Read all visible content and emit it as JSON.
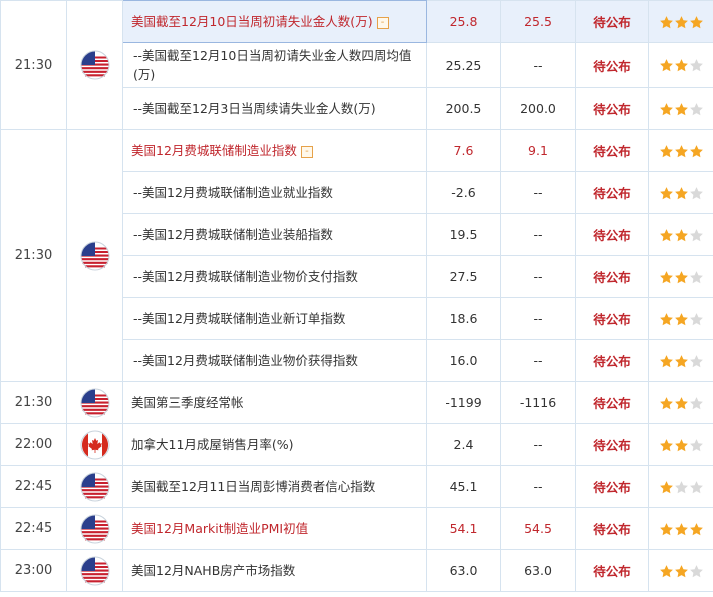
{
  "colors": {
    "highlight": "#c0272d",
    "star_on": "#f5a623",
    "star_off": "#d9d9d9",
    "border": "#d6e3ef"
  },
  "rows": [
    {
      "time": "21:30",
      "flag": "us-flag-icon",
      "name": "美国截至12月10日当周初请失业金人数(万)",
      "expand": "-",
      "previous": "25.8",
      "forecast": "25.5",
      "actual": "待公布",
      "stars": 3,
      "highlight": true,
      "selected": true
    },
    {
      "name": "--美国截至12月10日当周初请失业金人数四周均值(万)",
      "previous": "25.25",
      "forecast": "--",
      "actual": "待公布",
      "stars": 2
    },
    {
      "name": "--美国截至12月3日当周续请失业金人数(万)",
      "previous": "200.5",
      "forecast": "200.0",
      "actual": "待公布",
      "stars": 2
    },
    {
      "time": "21:30",
      "flag": "us-flag-icon",
      "name": "美国12月费城联储制造业指数",
      "expand": "-",
      "previous": "7.6",
      "forecast": "9.1",
      "actual": "待公布",
      "stars": 3,
      "highlight": true
    },
    {
      "name": "--美国12月费城联储制造业就业指数",
      "previous": "-2.6",
      "forecast": "--",
      "actual": "待公布",
      "stars": 2
    },
    {
      "name": "--美国12月费城联储制造业装船指数",
      "previous": "19.5",
      "forecast": "--",
      "actual": "待公布",
      "stars": 2
    },
    {
      "name": "--美国12月费城联储制造业物价支付指数",
      "previous": "27.5",
      "forecast": "--",
      "actual": "待公布",
      "stars": 2
    },
    {
      "name": "--美国12月费城联储制造业新订单指数",
      "previous": "18.6",
      "forecast": "--",
      "actual": "待公布",
      "stars": 2
    },
    {
      "name": "--美国12月费城联储制造业物价获得指数",
      "previous": "16.0",
      "forecast": "--",
      "actual": "待公布",
      "stars": 2
    },
    {
      "time": "21:30",
      "flag": "us-flag-icon",
      "name": "美国第三季度经常帐",
      "previous": "-1199",
      "forecast": "-1116",
      "actual": "待公布",
      "stars": 2
    },
    {
      "time": "22:00",
      "flag": "ca-flag-icon",
      "name": "加拿大11月成屋销售月率(%)",
      "previous": "2.4",
      "forecast": "--",
      "actual": "待公布",
      "stars": 2
    },
    {
      "time": "22:45",
      "flag": "us-flag-icon",
      "name": "美国截至12月11日当周彭博消费者信心指数",
      "previous": "45.1",
      "forecast": "--",
      "actual": "待公布",
      "stars": 1
    },
    {
      "time": "22:45",
      "flag": "us-flag-icon",
      "name": "美国12月Markit制造业PMI初值",
      "previous": "54.1",
      "forecast": "54.5",
      "actual": "待公布",
      "stars": 3,
      "highlight": true
    },
    {
      "time": "23:00",
      "flag": "us-flag-icon",
      "name": "美国12月NAHB房产市场指数",
      "previous": "63.0",
      "forecast": "63.0",
      "actual": "待公布",
      "stars": 2
    }
  ]
}
